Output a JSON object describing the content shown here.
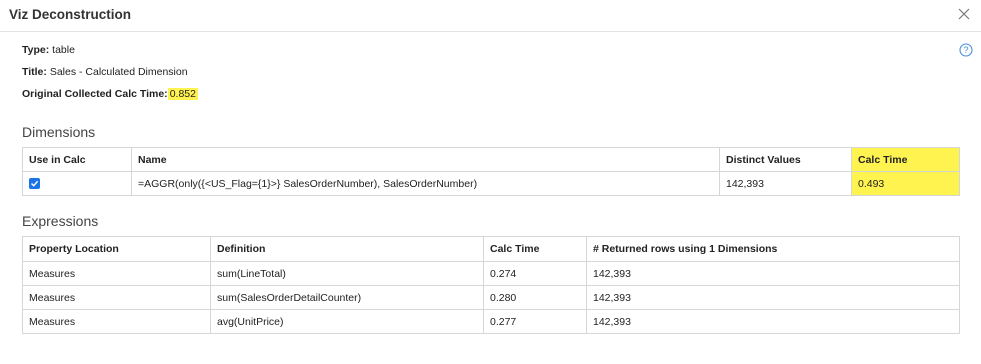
{
  "window": {
    "title": "Viz Deconstruction"
  },
  "meta": {
    "type_label": "Type:",
    "type_value": "table",
    "title_label": "Title:",
    "title_value": "Sales - Calculated Dimension",
    "calc_label": "Original Collected Calc Time:",
    "calc_value": "0.852"
  },
  "dimensions": {
    "heading": "Dimensions",
    "columns": [
      "Use in Calc",
      "Name",
      "Distinct Values",
      "Calc Time"
    ],
    "rows": [
      {
        "use_in_calc": true,
        "name": "=AGGR(only({<US_Flag={1}>} SalesOrderNumber), SalesOrderNumber)",
        "distinct": "142,393",
        "calc_time": "0.493"
      }
    ]
  },
  "expressions": {
    "heading": "Expressions",
    "columns": [
      "Property Location",
      "Definition",
      "Calc Time",
      "# Returned rows using 1 Dimensions"
    ],
    "rows": [
      {
        "location": "Measures",
        "definition": "sum(LineTotal)",
        "calc_time": "0.274",
        "rows": "142,393"
      },
      {
        "location": "Measures",
        "definition": "sum(SalesOrderDetailCounter)",
        "calc_time": "0.280",
        "rows": "142,393"
      },
      {
        "location": "Measures",
        "definition": "avg(UnitPrice)",
        "calc_time": "0.277",
        "rows": "142,393"
      }
    ]
  },
  "colors": {
    "highlight": "#fff44f",
    "checkbox": "#1a73e8",
    "border": "#d6d6d6"
  },
  "icons": {
    "close": "close-icon",
    "help": "help-icon",
    "checkbox": "checkbox-checked-icon"
  }
}
